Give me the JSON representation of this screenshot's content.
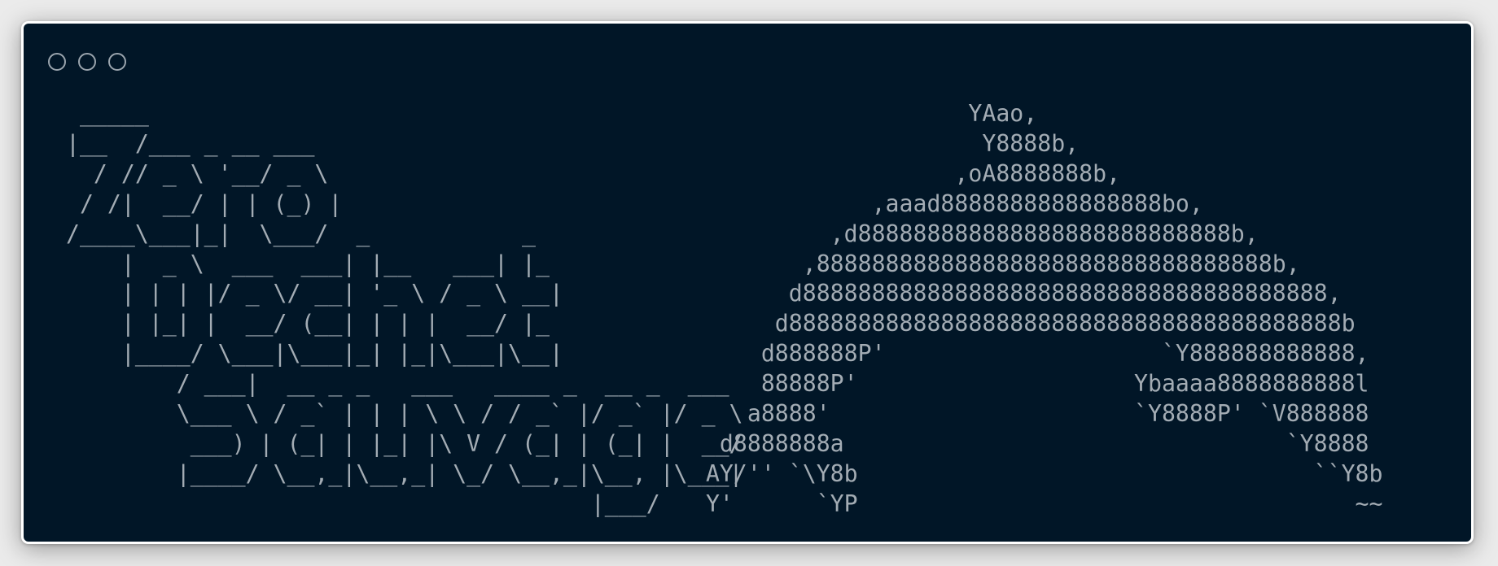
{
  "window": {
    "controls": [
      "close",
      "minimize",
      "maximize"
    ],
    "background": "#011627",
    "text_color": "#a3acb4"
  },
  "banner_text": "  _____\n |__  /___ _ __ ___\n   / // _ \\ '__/ _ \\\n  / /|  __/ | | (_) |\n /____\\___|_|  \\___/  _           _\n     |  _ \\  ___  ___| |__   ___| |_\n     | | | |/ _ \\/ __| '_ \\ / _ \\ __|\n     | |_| |  __/ (__| | | |  __/ |_\n     |____/ \\___|\\___|_| |_|\\___|\\__|\n         / ___|  __ _ _   ___   ____ _  __ _  ___\n         \\___ \\ / _` | | | \\ \\ / / _` |/ _` |/ _ \\\n          ___) | (_| | |_| |\\ V / (_| | (_| |  __/\n         |____/ \\__,_|\\__,_| \\_/ \\__,_|\\__, |\\___|\n                                       |___/",
  "logo_art": "                     YAao,\n                      Y8888b,\n                    ,oA8888888b,\n              ,aaad8888888888888888bo,\n           ,d888888888888888888888888888b,\n         ,888888888888888888888888888888888b,\n        d88888888888888888888888888888888888888,\n       d8888888888888888888888888888888888888888b\n      d888888P'                    `Y888888888888,\n      88888P'                    Ybaaaa8888888888l\n     a8888'                      `Y8888P' `V888888\n   d8888888a                                `Y8888\n  AY/'' `\\Y8b                                 ``Y8b\n  Y'      `YP                                    ~~"
}
